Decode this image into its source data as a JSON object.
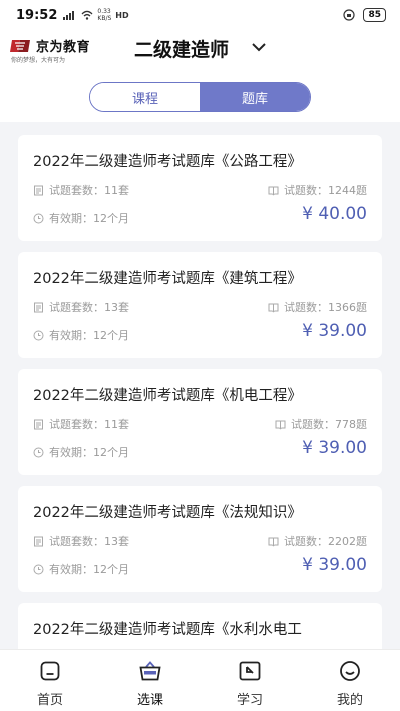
{
  "status_bar": {
    "time": "19:52",
    "speed_value": "0.33",
    "speed_unit": "KB/S",
    "hd": "HD",
    "battery": "85"
  },
  "header": {
    "logo_name": "京为教育",
    "logo_slogan": "你的梦想，大有可为",
    "title": "二级建造师"
  },
  "tabs": [
    {
      "label": "课程",
      "active": false
    },
    {
      "label": "题库",
      "active": true
    }
  ],
  "courses": [
    {
      "title": "2022年二级建造师考试题库《公路工程》",
      "sets": "试题套数：11套",
      "count": "试题数：1244题",
      "valid": "有效期：12个月",
      "price": "¥ 40.00"
    },
    {
      "title": "2022年二级建造师考试题库《建筑工程》",
      "sets": "试题套数：13套",
      "count": "试题数：1366题",
      "valid": "有效期：12个月",
      "price": "¥ 39.00"
    },
    {
      "title": "2022年二级建造师考试题库《机电工程》",
      "sets": "试题套数：11套",
      "count": "试题数：778题",
      "valid": "有效期：12个月",
      "price": "¥ 39.00"
    },
    {
      "title": "2022年二级建造师考试题库《法规知识》",
      "sets": "试题套数：13套",
      "count": "试题数：2202题",
      "valid": "有效期：12个月",
      "price": "¥ 39.00"
    },
    {
      "title": "2022年二级建造师考试题库《水利水电工",
      "sets": "",
      "count": "",
      "valid": "",
      "price": ""
    }
  ],
  "bottom_nav": [
    {
      "label": "首页",
      "icon": "home-icon"
    },
    {
      "label": "选课",
      "icon": "basket-icon",
      "active": true
    },
    {
      "label": "学习",
      "icon": "study-icon"
    },
    {
      "label": "我的",
      "icon": "smile-icon"
    }
  ],
  "colors": {
    "accent": "#6f79c9",
    "price": "#4f5fb3",
    "background": "#f3f4f7",
    "logo_red": "#c0282d"
  }
}
